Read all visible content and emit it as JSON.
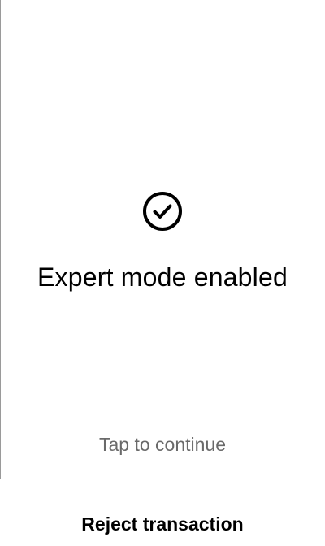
{
  "status": {
    "icon": "check-circle-icon",
    "title": "Expert mode enabled",
    "hint": "Tap to continue"
  },
  "footer": {
    "reject_label": "Reject transaction"
  },
  "colors": {
    "background": "#ffffff",
    "text": "#000000",
    "hint_text": "#6a6a6a",
    "divider": "#a8a8a8"
  }
}
